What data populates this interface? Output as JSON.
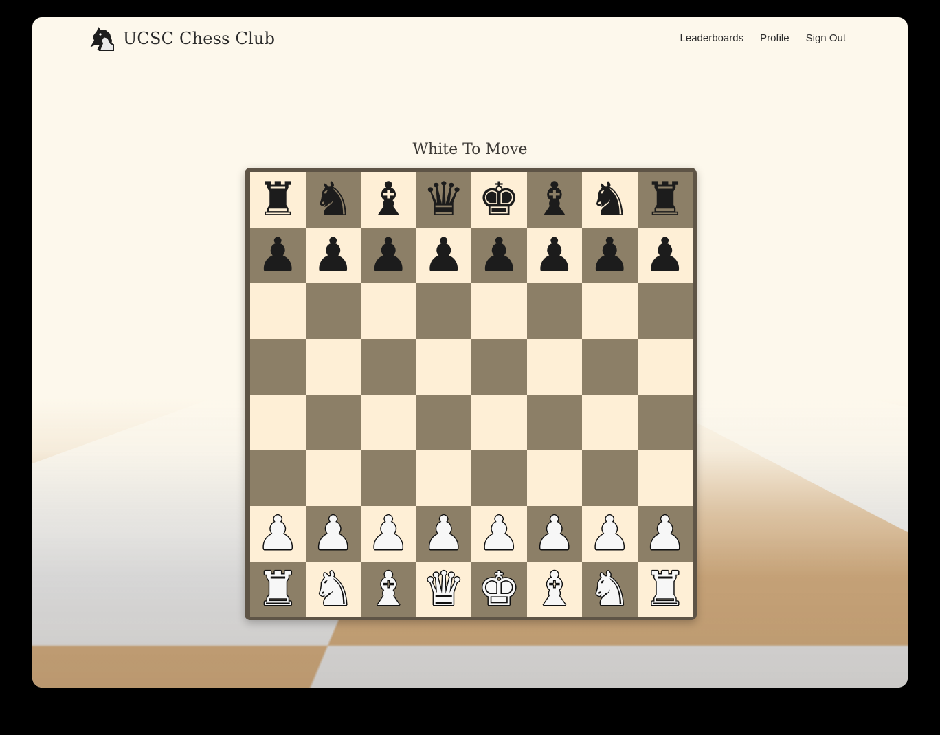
{
  "header": {
    "brand_name": "UCSC Chess Club",
    "logo_icon": "knight-logo-icon",
    "nav": [
      {
        "label": "Leaderboards"
      },
      {
        "label": "Profile"
      },
      {
        "label": "Sign Out"
      }
    ]
  },
  "game": {
    "status": "White To Move",
    "board": [
      [
        "bR",
        "bN",
        "bB",
        "bQ",
        "bK",
        "bB",
        "bN",
        "bR"
      ],
      [
        "bP",
        "bP",
        "bP",
        "bP",
        "bP",
        "bP",
        "bP",
        "bP"
      ],
      [
        "",
        "",
        "",
        "",
        "",
        "",
        "",
        ""
      ],
      [
        "",
        "",
        "",
        "",
        "",
        "",
        "",
        ""
      ],
      [
        "",
        "",
        "",
        "",
        "",
        "",
        "",
        ""
      ],
      [
        "",
        "",
        "",
        "",
        "",
        "",
        "",
        ""
      ],
      [
        "wP",
        "wP",
        "wP",
        "wP",
        "wP",
        "wP",
        "wP",
        "wP"
      ],
      [
        "wR",
        "wN",
        "wB",
        "wQ",
        "wK",
        "wB",
        "wN",
        "wR"
      ]
    ],
    "piece_glyphs": {
      "K": "♚",
      "Q": "♛",
      "R": "♜",
      "B": "♝",
      "N": "♞",
      "P": "♟"
    },
    "piece_names": {
      "K": "king",
      "Q": "queen",
      "R": "rook",
      "B": "bishop",
      "N": "knight",
      "P": "pawn"
    },
    "colors": {
      "light_square": "#feefd6",
      "dark_square": "#8c7f67",
      "frame": "#5e5446"
    }
  }
}
